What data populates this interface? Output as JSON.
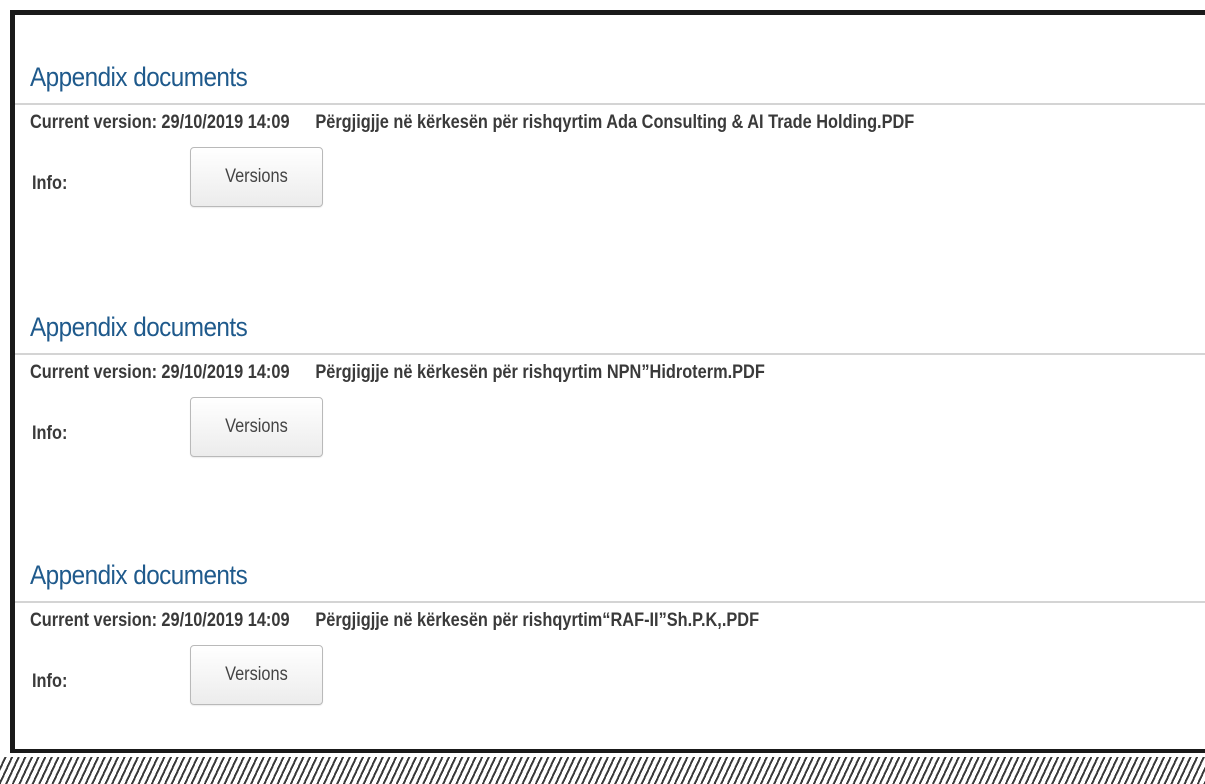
{
  "sections": [
    {
      "title": "Appendix documents",
      "version_label": "Current version:",
      "version_date": "29/10/2019 14:09",
      "file_name": "Përgjigjje në kërkesën për rishqyrtim Ada Consulting & AI Trade Holding.PDF",
      "info_label": "Info:",
      "versions_button": "Versions"
    },
    {
      "title": "Appendix documents",
      "version_label": "Current version:",
      "version_date": "29/10/2019 14:09",
      "file_name": "Përgjigjje në kërkesën për rishqyrtim NPN”Hidroterm.PDF",
      "info_label": "Info:",
      "versions_button": "Versions"
    },
    {
      "title": "Appendix documents",
      "version_label": "Current version:",
      "version_date": "29/10/2019 14:09",
      "file_name": "Përgjigjje në kërkesën për rishqyrtim“RAF-II”Sh.P.K,.PDF",
      "info_label": "Info:",
      "versions_button": "Versions"
    }
  ]
}
